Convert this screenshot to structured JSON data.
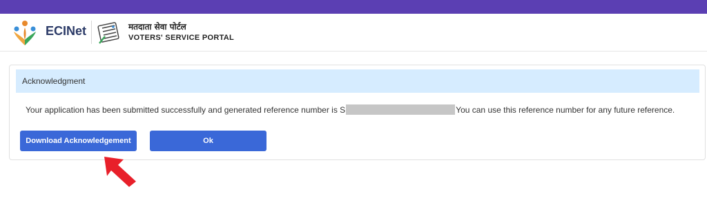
{
  "header": {
    "brand": "ECINet",
    "portal_hindi": "मतदाता सेवा पोर्टल",
    "portal_english": "VOTERS' SERVICE PORTAL",
    "brand_colors": {
      "topbar": "#5b3fb3",
      "button": "#3a68d8",
      "ack_header_bg": "#d6ecff",
      "arrow": "#e8202a"
    }
  },
  "ack": {
    "title": "Acknowledgment",
    "message_before": "Your application has been submitted successfully and generated reference number is S",
    "message_after": "You can use this reference number for any future reference.",
    "reference_number_redacted": true,
    "buttons": {
      "download_label": "Download Acknowledgement",
      "ok_label": "Ok"
    }
  },
  "icons": [
    "ecinet-logo-icon",
    "evm-logo-icon",
    "red-arrow-icon"
  ]
}
